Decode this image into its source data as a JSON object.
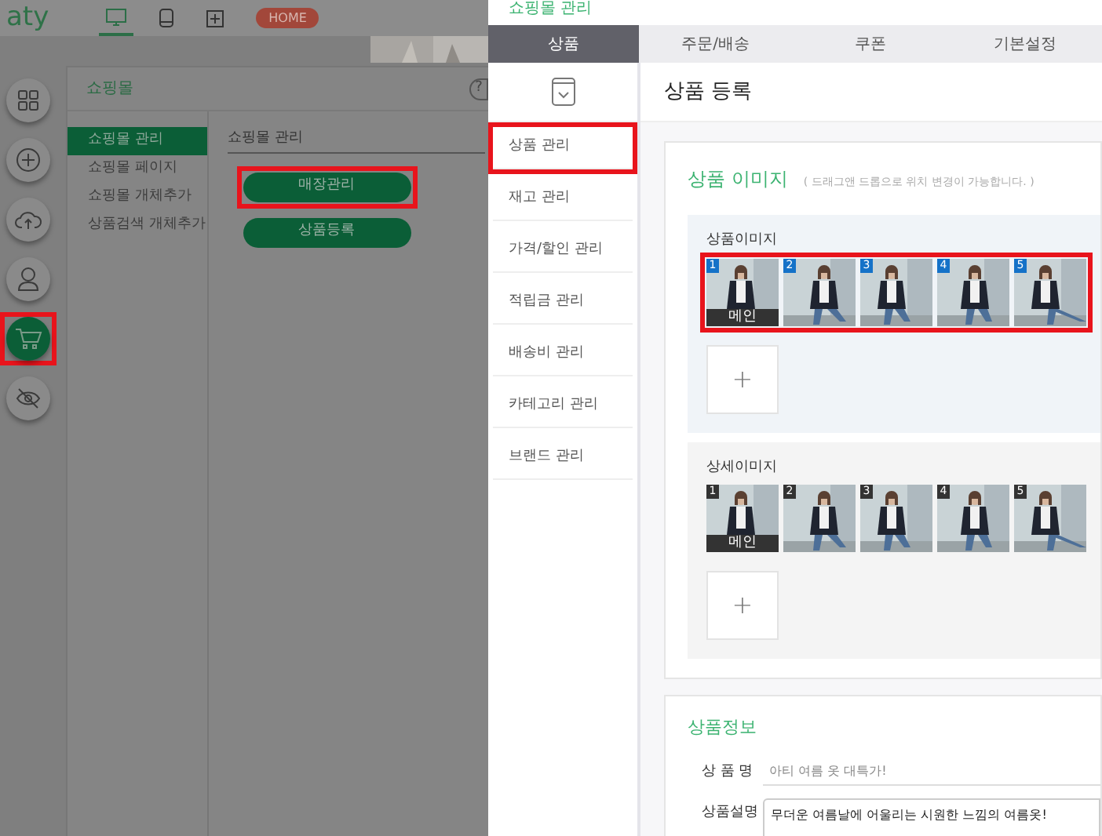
{
  "left": {
    "logo": "aty",
    "top_icons": [
      {
        "kind": "monitor",
        "selected": true
      },
      {
        "kind": "tablet",
        "selected": false
      },
      {
        "kind": "plus",
        "selected": false
      }
    ],
    "home_button": "HOME",
    "rail": [
      {
        "kind": "grid",
        "selected": false,
        "highlighted": false
      },
      {
        "kind": "plus",
        "selected": false,
        "highlighted": false
      },
      {
        "kind": "upload",
        "selected": false,
        "highlighted": false
      },
      {
        "kind": "user",
        "selected": false,
        "highlighted": false
      },
      {
        "kind": "cart",
        "selected": true,
        "highlighted": true
      },
      {
        "kind": "hidden",
        "selected": false,
        "highlighted": false
      }
    ],
    "panel": {
      "title": "쇼핑몰",
      "help": "?",
      "menu": [
        {
          "label": "쇼핑몰 관리",
          "selected": true
        },
        {
          "label": "쇼핑몰 페이지",
          "selected": false
        },
        {
          "label": "쇼핑몰 개체추가",
          "selected": false
        },
        {
          "label": "상품검색 개체추가",
          "selected": false
        }
      ],
      "heading": "쇼핑몰 관리",
      "buttons": [
        {
          "label": "매장관리",
          "highlighted": true
        },
        {
          "label": "상품등록",
          "highlighted": false
        }
      ]
    }
  },
  "right": {
    "breadcrumb": "쇼핑몰 관리",
    "tabs": [
      {
        "label": "상품",
        "selected": true
      },
      {
        "label": "주문/배송",
        "selected": false
      },
      {
        "label": "쿠폰",
        "selected": false
      },
      {
        "label": "기본설정",
        "selected": false
      }
    ],
    "side_menu": [
      {
        "label": "상품 관리",
        "highlighted": true
      },
      {
        "label": "재고 관리",
        "highlighted": false
      },
      {
        "label": "가격/할인 관리",
        "highlighted": false
      },
      {
        "label": "적립금 관리",
        "highlighted": false
      },
      {
        "label": "배송비 관리",
        "highlighted": false
      },
      {
        "label": "카테고리 관리",
        "highlighted": false
      },
      {
        "label": "브랜드 관리",
        "highlighted": false
      }
    ],
    "page_title": "상품 등록",
    "image_section": {
      "title": "상품 이미지",
      "hint": "( 드래그앤 드롭으로 위치 변경이 가능합니다. )",
      "groups": [
        {
          "label": "상품이미지",
          "color": "#1572c8",
          "highlighted": true,
          "thumbs": [
            {
              "number": "1",
              "main_label": "메인"
            },
            {
              "number": "2"
            },
            {
              "number": "3"
            },
            {
              "number": "4"
            },
            {
              "number": "5"
            }
          ],
          "add": "+"
        },
        {
          "label": "상세이미지",
          "color": "#333333",
          "highlighted": false,
          "thumbs": [
            {
              "number": "1",
              "main_label": "메인"
            },
            {
              "number": "2"
            },
            {
              "number": "3"
            },
            {
              "number": "4"
            },
            {
              "number": "5"
            }
          ],
          "add": "+"
        }
      ]
    },
    "info_section": {
      "title": "상품정보",
      "fields": [
        {
          "label": "상 품 명",
          "kind": "input",
          "placeholder": "아티 여름 옷 대특가!"
        },
        {
          "label": "상품설명",
          "kind": "textarea",
          "value": "무더운 여름날에 어울리는 시원한 느낌의 여름옷!"
        }
      ]
    }
  }
}
